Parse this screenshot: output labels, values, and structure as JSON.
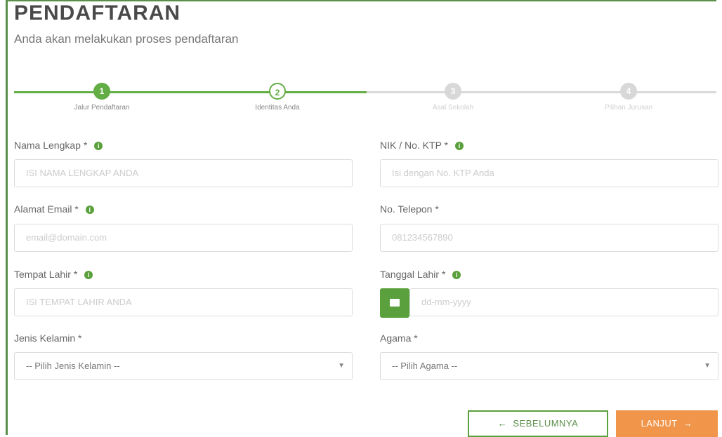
{
  "page": {
    "title": "PENDAFTARAN",
    "subtitle": "Anda akan melakukan proses pendaftaran"
  },
  "stepper": {
    "steps": [
      {
        "number": "1",
        "label": "Jalur Pendaftaran",
        "state": "completed"
      },
      {
        "number": "2",
        "label": "Identitas Anda",
        "state": "current"
      },
      {
        "number": "3",
        "label": "Asal Sekolah",
        "state": "pending"
      },
      {
        "number": "4",
        "label": "Pilihan Jurusan",
        "state": "pending"
      }
    ]
  },
  "form": {
    "nama_label": "Nama Lengkap *",
    "nama_placeholder": "ISI NAMA LENGKAP ANDA",
    "nik_label": "NIK / No. KTP *",
    "nik_placeholder": "Isi dengan No. KTP Anda",
    "email_label": "Alamat Email *",
    "email_placeholder": "email@domain.com",
    "telepon_label": "No. Telepon *",
    "telepon_placeholder": "081234567890",
    "tempat_label": "Tempat Lahir *",
    "tempat_placeholder": "ISI TEMPAT LAHIR ANDA",
    "tanggal_label": "Tanggal Lahir *",
    "tanggal_placeholder": "dd-mm-yyyy",
    "kelamin_label": "Jenis Kelamin *",
    "kelamin_value": "-- Pilih Jenis Kelamin --",
    "agama_label": "Agama *",
    "agama_value": "-- Pilih Agama --",
    "info_glyph": "i"
  },
  "buttons": {
    "prev_label": "SEBELUMNYA",
    "next_label": "LANJUT"
  },
  "icons": {
    "prev": "arrow-left-icon",
    "next": "arrow-right-icon",
    "calendar": "calendar-icon",
    "info": "info-icon",
    "dropdown": "chevron-down-icon"
  },
  "colors": {
    "accent_green": "#63ad45",
    "next_button": "#f0954a"
  }
}
